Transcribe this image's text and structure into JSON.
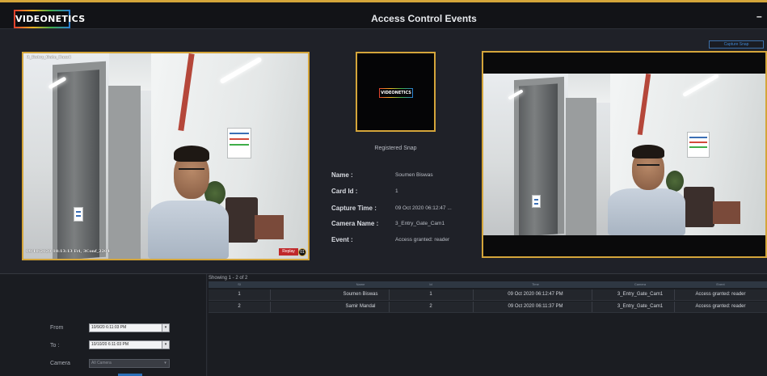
{
  "app": {
    "logo_text": "VIDEONETICS",
    "title": "Access Control Events",
    "window_control": "–",
    "capture_snap_label": "Capture Snap"
  },
  "camera_left": {
    "label": "3_Entry_Gate_Cam1",
    "timestamp": "09/10/2020 18:13:13  Fri,  3Conf_2204",
    "replay_label": "Replay",
    "replay_badge": "01"
  },
  "registered": {
    "logo_text": "VIDEONETICS",
    "caption": "Registered Snap"
  },
  "details": [
    {
      "key": "Name :",
      "value": "Soumen Biswas"
    },
    {
      "key": "Card Id :",
      "value": "1"
    },
    {
      "key": "Capture Time :",
      "value": "09 Oct 2020 06:12:47 ..."
    },
    {
      "key": "Camera Name :",
      "value": "3_Entry_Gate_Cam1"
    },
    {
      "key": "Event :",
      "value": "Access granted: reader"
    }
  ],
  "filters": {
    "from_label": "From",
    "from_value": "10/9/20 6:11:03 PM",
    "to_label": "To :",
    "to_value": "10/10/20 6:11:03 PM",
    "camera_label": "Camera",
    "camera_value": "All Camera",
    "dropdown_glyph": "▾"
  },
  "table": {
    "showing": "Showing 1 - 2 of 2",
    "columns": [
      "Sl",
      "Name",
      "Id",
      "Time",
      "Camera",
      "Event"
    ],
    "rows": [
      [
        "1",
        "Soumen Biswas",
        "1",
        "09 Oct 2020 06:12:47 PM",
        "3_Entry_Gate_Cam1",
        "Access granted: reader"
      ],
      [
        "2",
        "Samir Mandal",
        "2",
        "09 Oct 2020 06:11:37 PM",
        "3_Entry_Gate_Cam1",
        "Access granted: reader"
      ]
    ]
  },
  "colors": {
    "accent_frame": "#d4a53a",
    "header_bg": "#121317",
    "table_header": "#2e3742",
    "replay": "#c0282a",
    "link_blue": "#3f85d0"
  }
}
